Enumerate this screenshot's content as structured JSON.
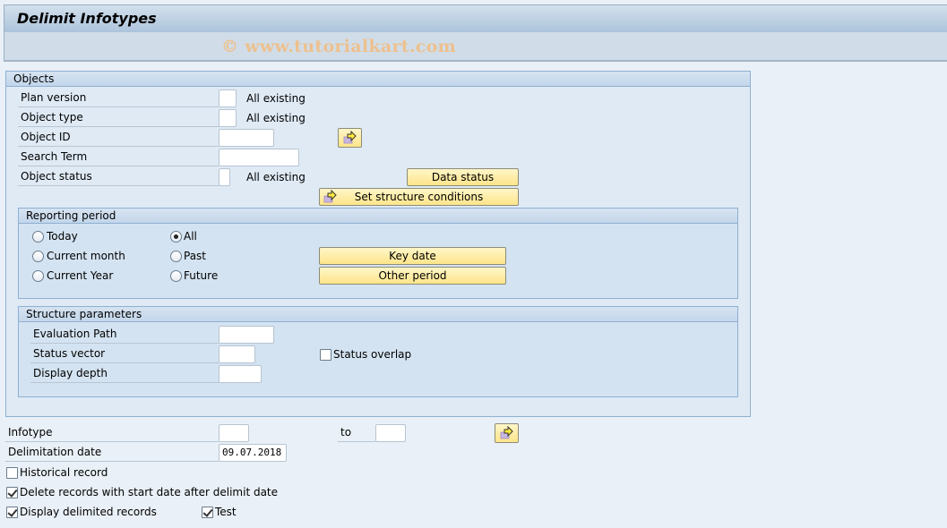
{
  "window": {
    "title": "Delimit Infotypes",
    "watermark": "© www.tutorialkart.com"
  },
  "objects": {
    "header": "Objects",
    "plan_version": {
      "label": "Plan version",
      "value": "",
      "hint": "All existing"
    },
    "object_type": {
      "label": "Object type",
      "value": "",
      "hint": "All existing"
    },
    "object_id": {
      "label": "Object ID",
      "value": ""
    },
    "search_term": {
      "label": "Search Term",
      "value": ""
    },
    "object_status": {
      "label": "Object status",
      "value": "",
      "hint": "All existing"
    },
    "data_status_button": "Data status",
    "set_structure_conditions_button": "Set structure conditions"
  },
  "reporting_period": {
    "header": "Reporting period",
    "options": [
      {
        "label": "Today",
        "selected": false
      },
      {
        "label": "Current month",
        "selected": false
      },
      {
        "label": "Current Year",
        "selected": false
      },
      {
        "label": "All",
        "selected": true
      },
      {
        "label": "Past",
        "selected": false
      },
      {
        "label": "Future",
        "selected": false
      }
    ],
    "key_date_button": "Key date",
    "other_period_button": "Other period"
  },
  "structure_parameters": {
    "header": "Structure parameters",
    "evaluation_path": {
      "label": "Evaluation Path",
      "value": ""
    },
    "status_vector": {
      "label": "Status vector",
      "value": ""
    },
    "display_depth": {
      "label": "Display depth",
      "value": ""
    },
    "status_overlap": {
      "label": "Status overlap",
      "checked": false
    }
  },
  "selection": {
    "infotype": {
      "label": "Infotype",
      "value": ""
    },
    "to": {
      "label": "to",
      "value": ""
    },
    "delimitation_date": {
      "label": "Delimitation date",
      "value": "09.07.2018"
    },
    "historical_record": {
      "label": "Historical record",
      "checked": false
    },
    "delete_records": {
      "label": "Delete records with start date after delimit date",
      "checked": true
    },
    "display_delimited": {
      "label": "Display delimited records",
      "checked": true
    },
    "test": {
      "label": "Test",
      "checked": true
    }
  },
  "icons": {
    "multiple_selection": "multiple-selection-arrow-icon"
  }
}
